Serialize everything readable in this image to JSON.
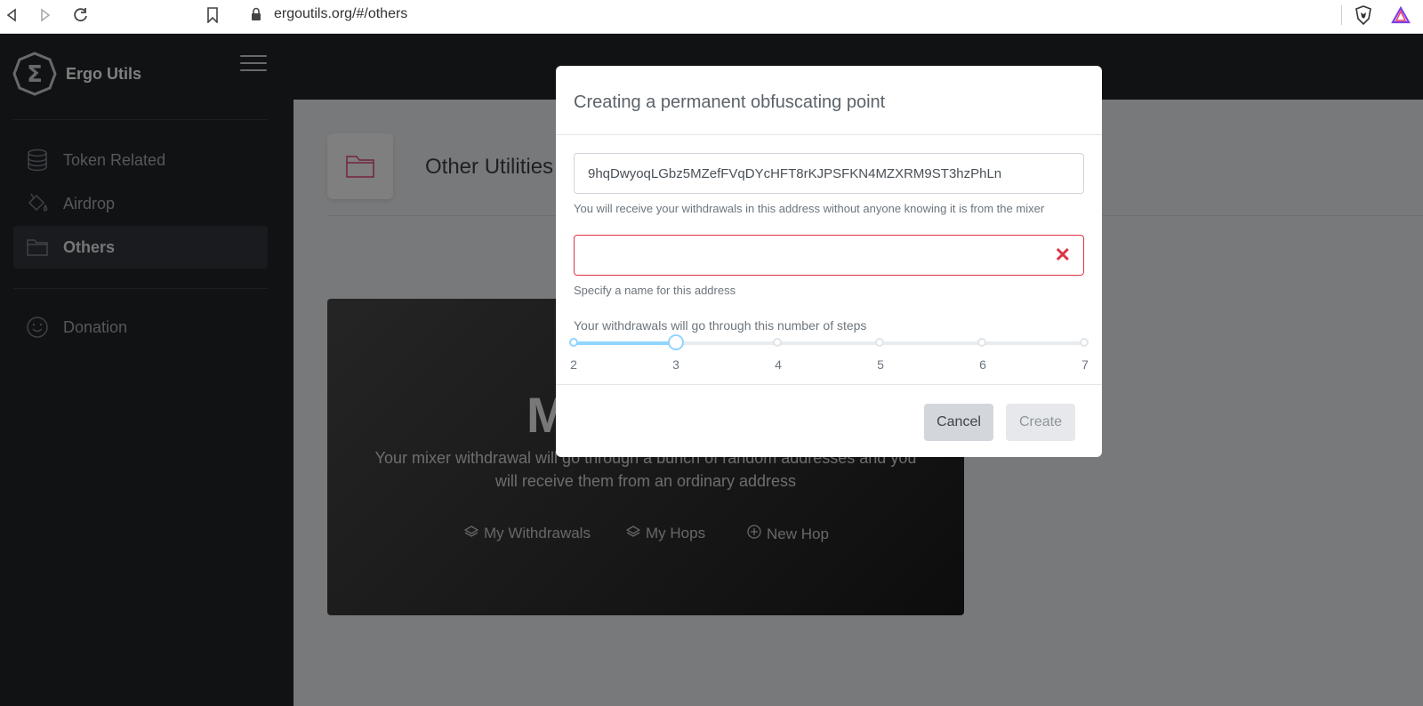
{
  "browser": {
    "url": "ergoutils.org/#/others"
  },
  "sidebar": {
    "brand": "Ergo Utils",
    "items": [
      {
        "label": "Token Related",
        "icon": "database-icon"
      },
      {
        "label": "Airdrop",
        "icon": "paint-bucket-icon"
      },
      {
        "label": "Others",
        "icon": "folder-icon",
        "active": true
      },
      {
        "label": "Donation",
        "icon": "smile-icon"
      }
    ]
  },
  "page": {
    "title": "Other Utilities",
    "card": {
      "title": "M",
      "description": "Your mixer withdrawal will go through a bunch of random addresses and you will receive them from an ordinary address",
      "links": [
        "My Withdrawals",
        "My Hops",
        "New Hop"
      ]
    }
  },
  "modal": {
    "title": "Creating a permanent obfuscating point",
    "address_value": "9hqDwyoqLGbz5MZefFVqDYcHFT8rKJPSFKN4MZXRM9ST3hzPhLn",
    "address_help": "You will receive your withdrawals in this address without anyone knowing it is from the mixer",
    "name_value": "",
    "name_help": "Specify a name for this address",
    "steps_label": "Your withdrawals will go through this number of steps",
    "steps_marks": [
      "2",
      "3",
      "4",
      "5",
      "6",
      "7"
    ],
    "steps_value": 3,
    "cancel_label": "Cancel",
    "create_label": "Create"
  },
  "colors": {
    "sidebar_bg": "#212529",
    "slider_accent": "#91d5ff",
    "error": "#dc3545"
  }
}
